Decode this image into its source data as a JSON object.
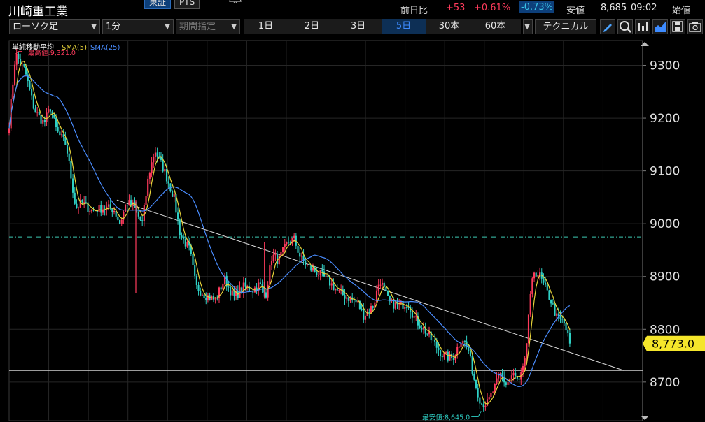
{
  "header": {
    "stock_name": "川崎重工業",
    "market_tabs": [
      {
        "label": "東証",
        "active": true
      },
      {
        "label": "PTS",
        "active": false
      }
    ],
    "prev_close_label": "前日比",
    "change": "+53",
    "change_pct": "+0.61%",
    "change_pct_alt": "-0.73%",
    "low_label": "安値",
    "low_value": "8,685",
    "low_time": "09:02",
    "open_label": "始値"
  },
  "toolbar": {
    "chart_type": "ローソク足",
    "interval": "1分",
    "period": "期間指定",
    "timeframes": [
      {
        "label": "1日",
        "active": false
      },
      {
        "label": "2日",
        "active": false
      },
      {
        "label": "3日",
        "active": false
      },
      {
        "label": "5日",
        "active": true
      },
      {
        "label": "30本",
        "active": false
      },
      {
        "label": "60本",
        "active": false
      }
    ],
    "technical": "テクニカル",
    "icons": [
      "pen-icon",
      "zoom-icon",
      "volume-icon",
      "area-chart-icon",
      "save-icon",
      "camera-icon"
    ]
  },
  "colors": {
    "up": "#ff3b5c",
    "down": "#2fd1c6",
    "sma5": "#e8d43a",
    "sma25": "#4a8dff",
    "active_blue": "#0d3f7a",
    "price_tag": "#f5e62b",
    "hline": "#3ec9b4"
  },
  "chart_data": {
    "type": "candlestick",
    "indicator_title": "単純移動平均",
    "legend": [
      {
        "name": "SMA(5)",
        "color": "#e8d43a"
      },
      {
        "name": "SMA(25)",
        "color": "#4a8dff"
      }
    ],
    "y_ticks": [
      9300,
      9200,
      9100,
      9000,
      8900,
      8800,
      8700
    ],
    "ylim": [
      8627,
      9347
    ],
    "current_price": 8773.0,
    "current_price_label": "8,773.0",
    "high_label": "最高値:9,321.0",
    "low_label": "最安値:8,645.0",
    "high": 9321.0,
    "low": 8645.0,
    "reference_lines": [
      {
        "type": "horizontal",
        "style": "dash-dot",
        "value": 8975
      },
      {
        "type": "horizontal",
        "style": "solid",
        "value": 8722
      }
    ],
    "trendline": [
      {
        "index": 0.17,
        "price": 9045
      },
      {
        "index": 0.97,
        "price": 8722
      }
    ],
    "price_path": [
      [
        0.0,
        9190
      ],
      [
        0.01,
        9321
      ],
      [
        0.025,
        9290
      ],
      [
        0.04,
        9215
      ],
      [
        0.055,
        9190
      ],
      [
        0.065,
        9220
      ],
      [
        0.075,
        9175
      ],
      [
        0.09,
        9150
      ],
      [
        0.105,
        9030
      ],
      [
        0.115,
        9040
      ],
      [
        0.13,
        9025
      ],
      [
        0.15,
        9030
      ],
      [
        0.165,
        9028
      ],
      [
        0.175,
        9000
      ],
      [
        0.185,
        9040
      ],
      [
        0.195,
        9035
      ],
      [
        0.21,
        9000
      ],
      [
        0.22,
        9090
      ],
      [
        0.23,
        9140
      ],
      [
        0.245,
        9100
      ],
      [
        0.26,
        9050
      ],
      [
        0.27,
        8980
      ],
      [
        0.285,
        8950
      ],
      [
        0.295,
        8880
      ],
      [
        0.31,
        8865
      ],
      [
        0.325,
        8855
      ],
      [
        0.34,
        8895
      ],
      [
        0.355,
        8860
      ],
      [
        0.37,
        8880
      ],
      [
        0.385,
        8875
      ],
      [
        0.395,
        8885
      ],
      [
        0.405,
        8865
      ],
      [
        0.415,
        8940
      ],
      [
        0.425,
        8930
      ],
      [
        0.44,
        8965
      ],
      [
        0.45,
        8970
      ],
      [
        0.46,
        8935
      ],
      [
        0.475,
        8915
      ],
      [
        0.49,
        8905
      ],
      [
        0.505,
        8890
      ],
      [
        0.52,
        8870
      ],
      [
        0.535,
        8860
      ],
      [
        0.55,
        8850
      ],
      [
        0.56,
        8825
      ],
      [
        0.575,
        8845
      ],
      [
        0.585,
        8895
      ],
      [
        0.6,
        8850
      ],
      [
        0.615,
        8845
      ],
      [
        0.63,
        8850
      ],
      [
        0.64,
        8820
      ],
      [
        0.655,
        8800
      ],
      [
        0.67,
        8775
      ],
      [
        0.685,
        8750
      ],
      [
        0.7,
        8745
      ],
      [
        0.715,
        8785
      ],
      [
        0.725,
        8760
      ],
      [
        0.735,
        8700
      ],
      [
        0.745,
        8660
      ],
      [
        0.755,
        8660
      ],
      [
        0.765,
        8685
      ],
      [
        0.775,
        8715
      ],
      [
        0.785,
        8695
      ],
      [
        0.795,
        8715
      ],
      [
        0.805,
        8700
      ],
      [
        0.815,
        8740
      ],
      [
        0.82,
        8830
      ],
      [
        0.828,
        8910
      ],
      [
        0.836,
        8905
      ],
      [
        0.845,
        8880
      ],
      [
        0.855,
        8855
      ],
      [
        0.865,
        8820
      ],
      [
        0.875,
        8815
      ],
      [
        0.885,
        8775
      ]
    ]
  }
}
